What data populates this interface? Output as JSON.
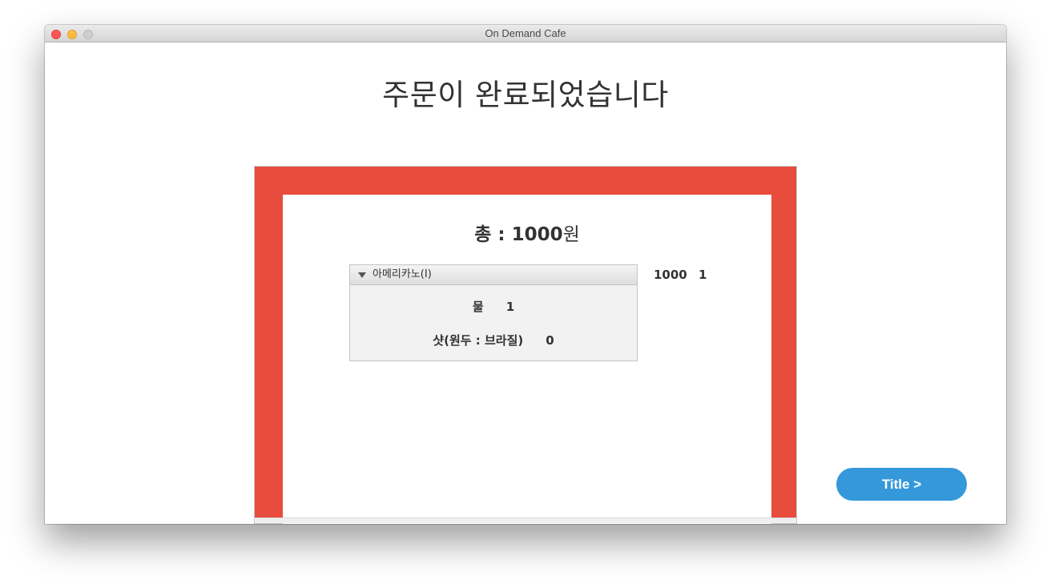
{
  "window": {
    "title": "On Demand Cafe"
  },
  "main": {
    "heading": "주문이 완료되었습니다",
    "total_label": "총 : ",
    "total_amount": "1000",
    "total_unit": "원"
  },
  "order": {
    "item_name": "아메리카노(I)",
    "item_price": "1000",
    "item_count": "1",
    "options": [
      {
        "name": "물",
        "qty": "1"
      },
      {
        "name": "샷(원두 : 브라질)",
        "qty": "0"
      }
    ]
  },
  "nav": {
    "title_button": "Title >"
  },
  "colors": {
    "frame_red": "#e74c3c",
    "button_blue": "#3498db"
  }
}
